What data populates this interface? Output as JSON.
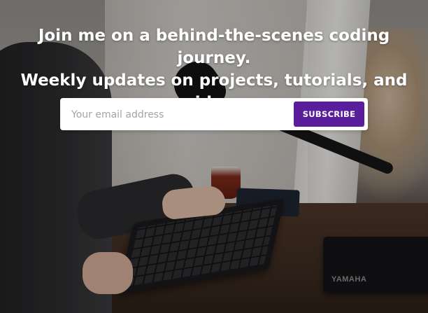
{
  "hero": {
    "headline_line1": "Join me on a behind-the-scenes coding journey.",
    "headline_line2": "Weekly updates on projects, tutorials, and videos"
  },
  "signup": {
    "email_placeholder": "Your email address",
    "email_value": "",
    "subscribe_label": "SUBSCRIBE"
  },
  "photo": {
    "mixer_brand": "YAMAHA"
  },
  "colors": {
    "accent": "#5a1d9c",
    "text_on_photo": "#ffffff",
    "input_background": "#ffffff"
  }
}
